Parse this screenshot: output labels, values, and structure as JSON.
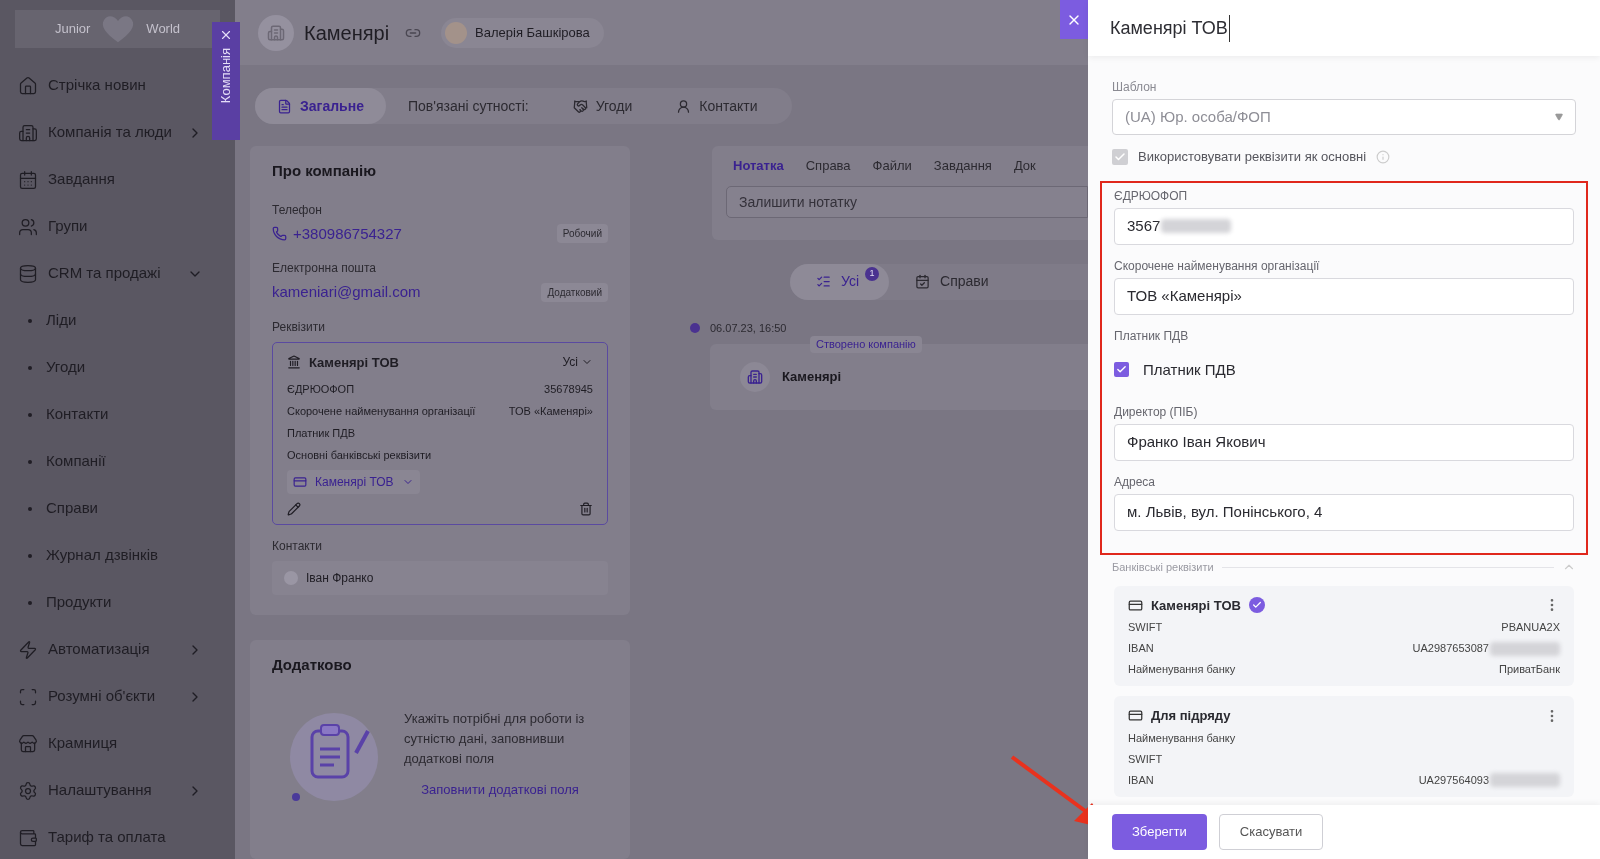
{
  "sidebar": {
    "logo": {
      "left": "Junior",
      "right": "World"
    },
    "items": [
      {
        "label": "Стрічка новин"
      },
      {
        "label": "Компанія та люди",
        "expanded": false
      },
      {
        "label": "Завдання"
      },
      {
        "label": "Групи"
      },
      {
        "label": "CRM та продажі",
        "expanded": true,
        "children": [
          {
            "label": "Ліди"
          },
          {
            "label": "Угоди"
          },
          {
            "label": "Контакти"
          },
          {
            "label": "Компанії"
          },
          {
            "label": "Справи"
          },
          {
            "label": "Журнал дзвінків"
          },
          {
            "label": "Продукти"
          }
        ]
      },
      {
        "label": "Автоматизація",
        "expanded": false
      },
      {
        "label": "Розумні об'єкти",
        "expanded": false
      },
      {
        "label": "Крамниця"
      },
      {
        "label": "Налаштування",
        "expanded": false
      },
      {
        "label": "Тариф та оплата"
      }
    ]
  },
  "side_tab": {
    "label": "Компанія"
  },
  "header": {
    "title": "Каменярі",
    "user": "Валерія Башкірова"
  },
  "tabs": [
    {
      "kind": "tab",
      "label": "Загальне",
      "selected": true
    },
    {
      "kind": "label",
      "label": "Пов'язані сутності:"
    },
    {
      "kind": "tab",
      "label": "Угоди",
      "selected": false
    },
    {
      "kind": "tab",
      "label": "Контакти",
      "selected": false
    }
  ],
  "about": {
    "title": "Про компанію",
    "phone_label": "Телефон",
    "phone": "+380986754327",
    "phone_tag": "Робочий",
    "email_label": "Електронна пошта",
    "email": "kameniari@gmail.com",
    "email_tag": "Додатковий",
    "requisites_label": "Реквізити",
    "requisite": {
      "title": "Каменярі ТОВ",
      "filter": "Усі",
      "rows": [
        {
          "label": "ЄДРЮОФОП",
          "value": "35678945"
        },
        {
          "label": "Скорочене найменування організації",
          "value": "ТОВ «Каменярі»"
        },
        {
          "label": "Платник ПДВ"
        },
        {
          "label": "Основні банківські реквізити"
        }
      ],
      "bank": "Каменярі ТОВ"
    },
    "contacts_label": "Контакти",
    "contacts": [
      "Іван Франко"
    ]
  },
  "extra": {
    "title": "Додатково",
    "text": "Укажіть потрібні для роботи із сутністю дані, заповнивши додаткові поля",
    "link": "Заповнити додаткові поля"
  },
  "notes": {
    "tabs": [
      {
        "label": "Нотатка",
        "selected": true
      },
      {
        "label": "Справа",
        "selected": false
      },
      {
        "label": "Файли",
        "selected": false
      },
      {
        "label": "Завдання",
        "selected": false
      },
      {
        "label": "Док",
        "selected": false
      }
    ],
    "placeholder": "Залишити нотатку"
  },
  "filters": [
    {
      "label": "Усі",
      "badge": "1",
      "selected": true
    },
    {
      "label": "Справи",
      "selected": false
    }
  ],
  "timeline": [
    {
      "time": "06.07.23, 16:50",
      "tag": "Створено компанію",
      "title": "Каменярі"
    }
  ],
  "panel": {
    "title": "Каменярі ТОВ",
    "template_label": "Шаблон",
    "template_value": "(UA) Юр. особа/ФОП",
    "use_as_main": {
      "label": "Використовувати реквізити як основні",
      "checked": true,
      "disabled": true
    },
    "fields": [
      {
        "kind": "input",
        "label": "ЄДРЮОФОП",
        "value": "3567",
        "blurred": true
      },
      {
        "kind": "input",
        "label": "Скорочене найменування організації",
        "value": "ТОВ «Каменярі»"
      },
      {
        "kind": "checkbox",
        "label": "Платник ПДВ",
        "option": "Платник ПДВ",
        "checked": true
      },
      {
        "kind": "input",
        "label": "Директор (ПІБ)",
        "value": "Франко Іван Якович"
      },
      {
        "kind": "input",
        "label": "Адреса",
        "value": "м. Львів, вул. Понінського, 4"
      }
    ],
    "bank_label": "Банківські реквізити",
    "bank_accounts": [
      {
        "name": "Каменярі ТОВ",
        "main": true,
        "rows": [
          {
            "label": "SWIFT",
            "value": "PBANUA2X"
          },
          {
            "label": "IBAN",
            "value": "UA2987653087",
            "blurred": true
          },
          {
            "label": "Найменування банку",
            "value": "ПриватБанк"
          }
        ]
      },
      {
        "name": "Для підряду",
        "main": false,
        "rows": [
          {
            "label": "Найменування банку"
          },
          {
            "label": "SWIFT"
          },
          {
            "label": "IBAN",
            "value": "UA297564093",
            "blurred": true
          }
        ]
      }
    ],
    "save": "Зберегти",
    "cancel": "Скасувати"
  }
}
